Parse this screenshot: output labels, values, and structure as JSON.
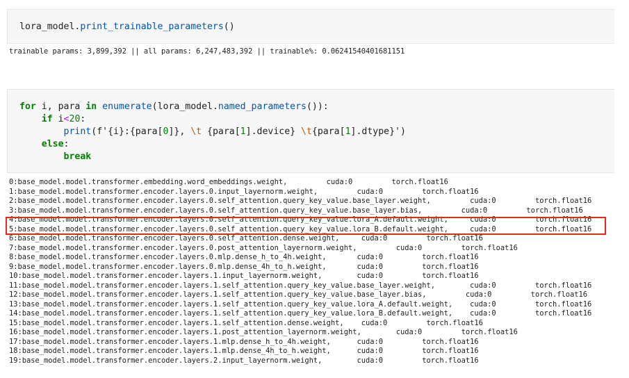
{
  "cell1": {
    "code": {
      "obj": "lora_model",
      "dot": ".",
      "method": "print_trainable_parameters",
      "parens": "()"
    },
    "output": "trainable params: 3,899,392 || all params: 6,247,483,392 || trainable%: 0.06241540401681151"
  },
  "cell2": {
    "code": {
      "for_kw": "for",
      "vars": " i, para ",
      "in_kw": "in",
      "enumerate_fn": "enumerate",
      "enum_open": "(",
      "model": "lora_model",
      "dot": ".",
      "named_params": "named_parameters",
      "enum_close": "()):",
      "if_kw": "if",
      "cond_var": " i",
      "cond_op": "<",
      "cond_num": "20",
      "cond_colon": ":",
      "print_fn": "print",
      "print_open": "(",
      "fstr_start": "f'",
      "fstr_part1": "{i}:{para[",
      "fstr_idx0": "0",
      "fstr_part2": "]}, ",
      "tab1": "\\t",
      "fstr_part3": " {para[",
      "fstr_idx1a": "1",
      "fstr_part4": "].device} ",
      "tab2": "\\t",
      "fstr_part5": "{para[",
      "fstr_idx1b": "1",
      "fstr_part6": "].dtype}'",
      "print_close": ")",
      "else_kw": "else",
      "else_colon": ":",
      "break_kw": "break"
    },
    "output_lines": [
      "0:base_model.model.transformer.embedding.word_embeddings.weight,         cuda:0         torch.float16",
      "1:base_model.model.transformer.encoder.layers.0.input_layernorm.weight,         cuda:0         torch.float16",
      "2:base_model.model.transformer.encoder.layers.0.self_attention.query_key_value.base_layer.weight,         cuda:0         torch.float16",
      "3:base_model.model.transformer.encoder.layers.0.self_attention.query_key_value.base_layer.bias,         cuda:0         torch.float16",
      "4:base_model.model.transformer.encoder.layers.0.self_attention.query_key_value.lora_A.default.weight,     cuda:0         torch.float16",
      "5:base_model.model.transformer.encoder.layers.0.self_attention.query_key_value.lora_B.default.weight,     cuda:0         torch.float16",
      "6:base_model.model.transformer.encoder.layers.0.self_attention.dense.weight,     cuda:0         torch.float16",
      "7:base_model.model.transformer.encoder.layers.0.post_attention_layernorm.weight,         cuda:0         torch.float16",
      "8:base_model.model.transformer.encoder.layers.0.mlp.dense_h_to_4h.weight,       cuda:0         torch.float16",
      "9:base_model.model.transformer.encoder.layers.0.mlp.dense_4h_to_h.weight,       cuda:0         torch.float16",
      "10:base_model.model.transformer.encoder.layers.1.input_layernorm.weight,        cuda:0         torch.float16",
      "11:base_model.model.transformer.encoder.layers.1.self_attention.query_key_value.base_layer.weight,        cuda:0         torch.float16",
      "12:base_model.model.transformer.encoder.layers.1.self_attention.query_key_value.base_layer.bias,         cuda:0         torch.float16",
      "13:base_model.model.transformer.encoder.layers.1.self_attention.query_key_value.lora_A.default.weight,    cuda:0         torch.float16",
      "14:base_model.model.transformer.encoder.layers.1.self_attention.query_key_value.lora_B.default.weight,    cuda:0         torch.float16",
      "15:base_model.model.transformer.encoder.layers.1.self_attention.dense.weight,    cuda:0         torch.float16",
      "16:base_model.model.transformer.encoder.layers.1.post_attention_layernorm.weight,        cuda:0         torch.float16",
      "17:base_model.model.transformer.encoder.layers.1.mlp.dense_h_to_4h.weight,      cuda:0         torch.float16",
      "18:base_model.model.transformer.encoder.layers.1.mlp.dense_4h_to_h.weight,      cuda:0         torch.float16",
      "19:base_model.model.transformer.encoder.layers.2.input_layernorm.weight,        cuda:0         torch.float16"
    ],
    "highlight_color": "#e8281e"
  }
}
